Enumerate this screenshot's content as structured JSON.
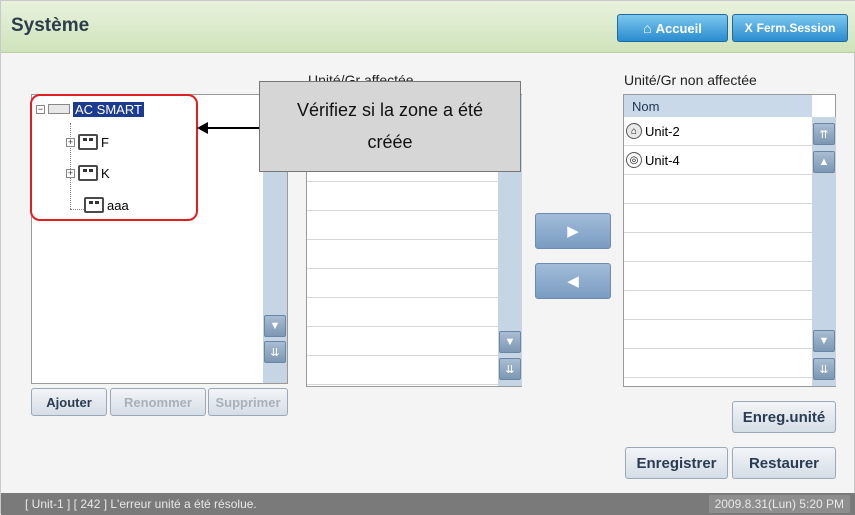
{
  "header": {
    "title": "Système",
    "home_label": "Accueil",
    "logout_label": "Ferm.Session"
  },
  "tree": {
    "root": "AC SMART",
    "children": [
      "F",
      "K",
      "aaa"
    ]
  },
  "assigned": {
    "label": "Unité/Gr affectée",
    "rows": [
      "",
      "",
      "",
      "",
      "",
      "",
      "",
      "",
      "",
      "",
      ""
    ]
  },
  "unassigned": {
    "label": "Unité/Gr non affectée",
    "column": "Nom",
    "rows": [
      "Unit-2",
      "Unit-4"
    ]
  },
  "buttons": {
    "add": "Ajouter",
    "rename": "Renommer",
    "delete": "Supprimer",
    "save_unit": "Enreg.unité",
    "save": "Enregistrer",
    "restore": "Restaurer"
  },
  "callout": {
    "line1": "Vérifiez si la zone a été",
    "line2": "créée"
  },
  "status": {
    "message": "[ Unit-1 ] [ 242 ] L'erreur unité a été résolue.",
    "datetime": "2009.8.31(Lun)  5:20 PM"
  },
  "colors": {
    "accent": "#2a8ccf",
    "highlight": "#e02020",
    "selection": "#1a3b8f"
  }
}
